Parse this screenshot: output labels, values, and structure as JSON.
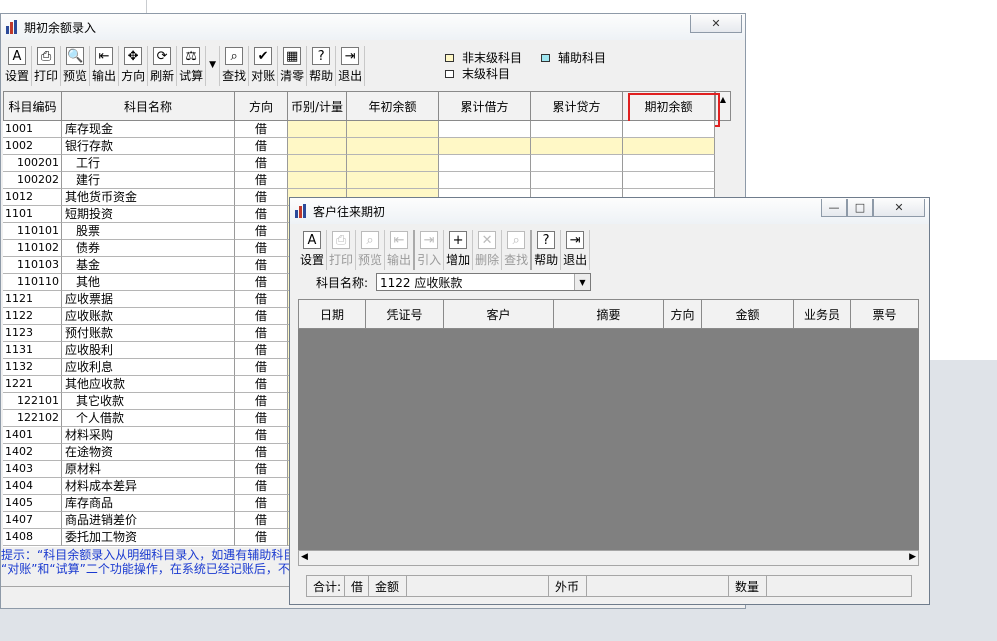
{
  "main": {
    "title": "期初余额录入",
    "toolbar": [
      {
        "label": "设置",
        "icon": "settings-icon",
        "glyph": "A"
      },
      {
        "label": "打印",
        "icon": "print-icon",
        "glyph": "⎙"
      },
      {
        "label": "预览",
        "icon": "preview-icon",
        "glyph": "🔍"
      },
      {
        "label": "输出",
        "icon": "export-icon",
        "glyph": "⇤"
      },
      {
        "label": "方向",
        "icon": "direction-icon",
        "glyph": "✥"
      },
      {
        "label": "刷新",
        "icon": "refresh-icon",
        "glyph": "⟳"
      },
      {
        "label": "试算",
        "icon": "balance-scale-icon",
        "glyph": "⚖"
      },
      {
        "label": "查找",
        "icon": "find-icon",
        "glyph": "⌕"
      },
      {
        "label": "对账",
        "icon": "reconcile-icon",
        "glyph": "✔"
      },
      {
        "label": "清零",
        "icon": "clear-icon",
        "glyph": "▦"
      },
      {
        "label": "帮助",
        "icon": "help-icon",
        "glyph": "?"
      },
      {
        "label": "退出",
        "icon": "exit-icon",
        "glyph": "⇥"
      }
    ],
    "legend": [
      {
        "label": "非末级科目",
        "color": "#fff8c6"
      },
      {
        "label": "辅助科目",
        "color": "#9fe6f0"
      },
      {
        "label": "末级科目",
        "color": "#ffffff"
      }
    ],
    "columns": [
      "科目编码",
      "科目名称",
      "方向",
      "币别/计量",
      "年初余额",
      "累计借方",
      "累计贷方",
      "期初余额"
    ],
    "rows": [
      {
        "code": "1001",
        "name": "库存现金",
        "dir": "借",
        "level": 1,
        "hl": true
      },
      {
        "code": "1002",
        "name": "银行存款",
        "dir": "借",
        "level": 1,
        "hl": true
      },
      {
        "code": "100201",
        "name": "工行",
        "dir": "借",
        "level": 2,
        "hl": false
      },
      {
        "code": "100202",
        "name": "建行",
        "dir": "借",
        "level": 2,
        "hl": false
      },
      {
        "code": "1012",
        "name": "其他货币资金",
        "dir": "借",
        "level": 1,
        "hl": false
      },
      {
        "code": "1101",
        "name": "短期投资",
        "dir": "借",
        "level": 1,
        "hl": false
      },
      {
        "code": "110101",
        "name": "股票",
        "dir": "借",
        "level": 2,
        "hl": false
      },
      {
        "code": "110102",
        "name": "债券",
        "dir": "借",
        "level": 2,
        "hl": false
      },
      {
        "code": "110103",
        "name": "基金",
        "dir": "借",
        "level": 2,
        "hl": false
      },
      {
        "code": "110110",
        "name": "其他",
        "dir": "借",
        "level": 2,
        "hl": false
      },
      {
        "code": "1121",
        "name": "应收票据",
        "dir": "借",
        "level": 1,
        "hl": false
      },
      {
        "code": "1122",
        "name": "应收账款",
        "dir": "借",
        "level": 1,
        "hl": false
      },
      {
        "code": "1123",
        "name": "预付账款",
        "dir": "借",
        "level": 1,
        "hl": false
      },
      {
        "code": "1131",
        "name": "应收股利",
        "dir": "借",
        "level": 1,
        "hl": false
      },
      {
        "code": "1132",
        "name": "应收利息",
        "dir": "借",
        "level": 1,
        "hl": false
      },
      {
        "code": "1221",
        "name": "其他应收款",
        "dir": "借",
        "level": 1,
        "hl": false
      },
      {
        "code": "122101",
        "name": "其它收款",
        "dir": "借",
        "level": 2,
        "hl": false
      },
      {
        "code": "122102",
        "name": "个人借款",
        "dir": "借",
        "level": 2,
        "hl": false
      },
      {
        "code": "1401",
        "name": "材料采购",
        "dir": "借",
        "level": 1,
        "hl": false
      },
      {
        "code": "1402",
        "name": "在途物资",
        "dir": "借",
        "level": 1,
        "hl": false
      },
      {
        "code": "1403",
        "name": "原材料",
        "dir": "借",
        "level": 1,
        "hl": false
      },
      {
        "code": "1404",
        "name": "材料成本差异",
        "dir": "借",
        "level": 1,
        "hl": false
      },
      {
        "code": "1405",
        "name": "库存商品",
        "dir": "借",
        "level": 1,
        "hl": false
      },
      {
        "code": "1407",
        "name": "商品进销差价",
        "dir": "借",
        "level": 1,
        "hl": false
      },
      {
        "code": "1408",
        "name": "委托加工物资",
        "dir": "借",
        "level": 1,
        "hl": false
      }
    ],
    "hint_line1": "提示：“科目余额录入从明细科目录入，如遇有辅助科目",
    "hint_line2": "“对账”和“试算”二个功能操作，在系统已经记账后，不"
  },
  "dialog": {
    "title": "客户往来期初",
    "toolbar": [
      {
        "label": "设置",
        "icon": "settings-icon",
        "glyph": "A",
        "enabled": true
      },
      {
        "label": "打印",
        "icon": "print-icon",
        "glyph": "⎙",
        "enabled": false
      },
      {
        "label": "预览",
        "icon": "preview-icon",
        "glyph": "⌕",
        "enabled": false
      },
      {
        "label": "输出",
        "icon": "export-icon",
        "glyph": "⇤",
        "enabled": false
      },
      {
        "label": "引入",
        "icon": "import-icon",
        "glyph": "⇥",
        "enabled": false
      },
      {
        "label": "增加",
        "icon": "add-icon",
        "glyph": "+",
        "enabled": true
      },
      {
        "label": "删除",
        "icon": "delete-icon",
        "glyph": "✕",
        "enabled": false
      },
      {
        "label": "查找",
        "icon": "find-icon",
        "glyph": "⌕",
        "enabled": false
      },
      {
        "label": "帮助",
        "icon": "help-icon",
        "glyph": "?",
        "enabled": true
      },
      {
        "label": "退出",
        "icon": "exit-icon",
        "glyph": "⇥",
        "enabled": true
      }
    ],
    "subject_label": "科目名称:",
    "subject_value": "1122 应收账款",
    "columns": [
      "日期",
      "凭证号",
      "客户",
      "摘要",
      "方向",
      "金额",
      "业务员",
      "票号"
    ],
    "footer": [
      "合计:",
      "借",
      "金额",
      "",
      "外币",
      "",
      "数量",
      ""
    ]
  }
}
